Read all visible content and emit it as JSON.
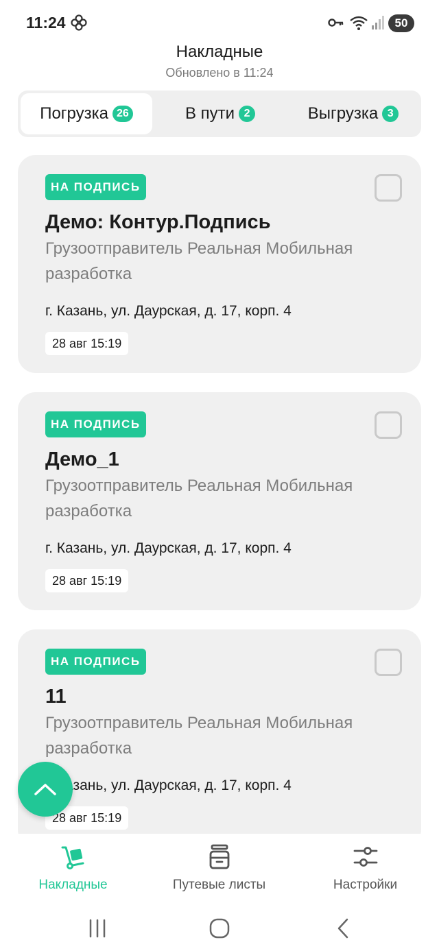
{
  "statusbar": {
    "time": "11:24",
    "battery": "50",
    "icons": [
      "flower-icon",
      "key-icon",
      "wifi-icon",
      "signal-icon"
    ]
  },
  "header": {
    "title": "Накладные",
    "subtitle": "Обновлено в 11:24"
  },
  "tabs": [
    {
      "label": "Погрузка",
      "count": "26",
      "active": true
    },
    {
      "label": "В пути",
      "count": "2",
      "active": false
    },
    {
      "label": "Выгрузка",
      "count": "3",
      "active": false
    }
  ],
  "cards": [
    {
      "status": "НА ПОДПИСЬ",
      "title": "Демо: Контур.Подпись",
      "sender": "Грузоотправитель Реальная Мобильная разработка",
      "address": "г. Казань, ул. Даурская, д. 17, корп. 4",
      "date": "28 авг 15:19"
    },
    {
      "status": "НА ПОДПИСЬ",
      "title": "Демо_1",
      "sender": "Грузоотправитель Реальная Мобильная разработка",
      "address": "г. Казань, ул. Даурская, д. 17, корп. 4",
      "date": "28 авг 15:19"
    },
    {
      "status": "НА ПОДПИСЬ",
      "title": "11",
      "sender": "Грузоотправитель Реальная Мобильная разработка",
      "address": "г. Казань, ул. Даурская, д. 17, корп. 4",
      "date": "28 авг 15:19"
    }
  ],
  "fab": {
    "icon": "chevron-up-icon"
  },
  "bottom_nav": [
    {
      "label": "Накладные",
      "icon": "cart-icon",
      "active": true
    },
    {
      "label": "Путевые листы",
      "icon": "archive-box-icon",
      "active": false
    },
    {
      "label": "Настройки",
      "icon": "sliders-icon",
      "active": false
    }
  ],
  "colors": {
    "accent": "#21c796",
    "card_bg": "#f0f0f0",
    "muted_text": "#7e7e7e"
  }
}
